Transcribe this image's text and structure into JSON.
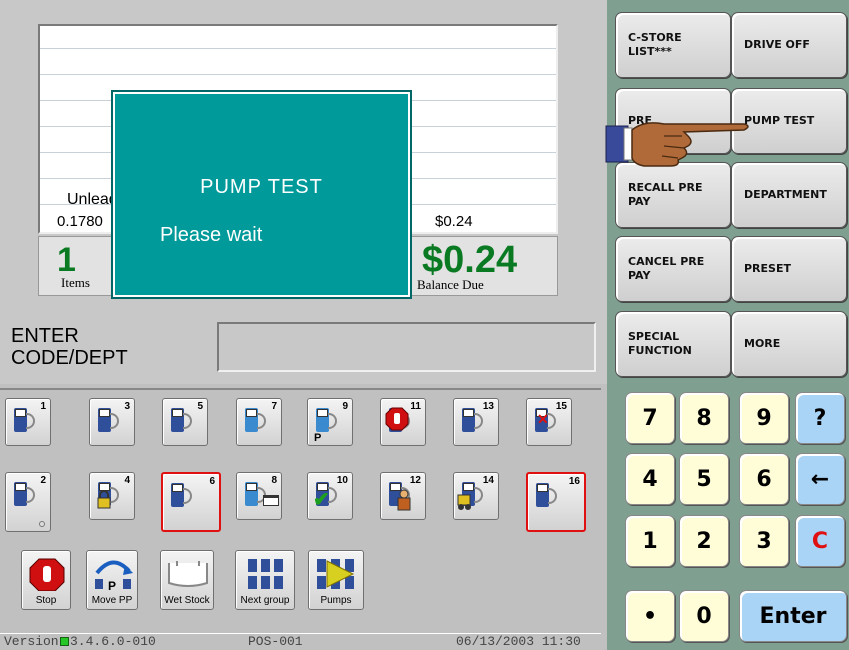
{
  "receipt": {
    "item_name": "Unleaded",
    "item_price": "0.1780",
    "item_amount": "$0.24"
  },
  "totals": {
    "items_count": "1",
    "items_label": "Items",
    "balance_value": "$0.24",
    "balance_label": "Balance Due"
  },
  "popup": {
    "title": "PUMP TEST",
    "message": "Please wait"
  },
  "prompt": {
    "line1": "ENTER",
    "line2": "CODE/DEPT",
    "entry_value": ""
  },
  "function_keys": [
    {
      "label": "C-STORE LIST***"
    },
    {
      "label": "DRIVE OFF"
    },
    {
      "label": "PRE"
    },
    {
      "label": "PUMP TEST"
    },
    {
      "label": "RECALL PRE PAY"
    },
    {
      "label": "DEPARTMENT"
    },
    {
      "label": "CANCEL PRE PAY"
    },
    {
      "label": "PRESET"
    },
    {
      "label": "SPECIAL FUNCTION"
    },
    {
      "label": "MORE"
    }
  ],
  "keypad": [
    "7",
    "8",
    "9",
    "?",
    "4",
    "5",
    "6",
    "←",
    "1",
    "2",
    "3",
    "C",
    "•",
    "0",
    "Enter"
  ],
  "pumps": [
    {
      "num": "1"
    },
    {
      "num": "3"
    },
    {
      "num": "5"
    },
    {
      "num": "7"
    },
    {
      "num": "9"
    },
    {
      "num": "11"
    },
    {
      "num": "13"
    },
    {
      "num": "15"
    },
    {
      "num": "2"
    },
    {
      "num": "4"
    },
    {
      "num": "6"
    },
    {
      "num": "8"
    },
    {
      "num": "10"
    },
    {
      "num": "12"
    },
    {
      "num": "14"
    },
    {
      "num": "16"
    }
  ],
  "pump_letter": "P",
  "func_buttons": [
    {
      "label": "Stop"
    },
    {
      "label": "Move PP"
    },
    {
      "label": "Wet Stock"
    },
    {
      "label": "Next group"
    },
    {
      "label": "Pumps"
    }
  ],
  "move_pp_letter": "P",
  "status": {
    "version_label": "Version",
    "version_value": "3.4.6.0-010",
    "terminal": "POS-001",
    "datetime": "06/13/2003 11:30"
  },
  "colors": {
    "popup_bg": "#009a9a",
    "total_green": "#0a7a22",
    "panel_green": "#7fa090",
    "key_yellow": "#fffdd8",
    "key_blue": "#a9d4f5",
    "clear_red": "#e01010",
    "selected_border": "#e01010"
  }
}
